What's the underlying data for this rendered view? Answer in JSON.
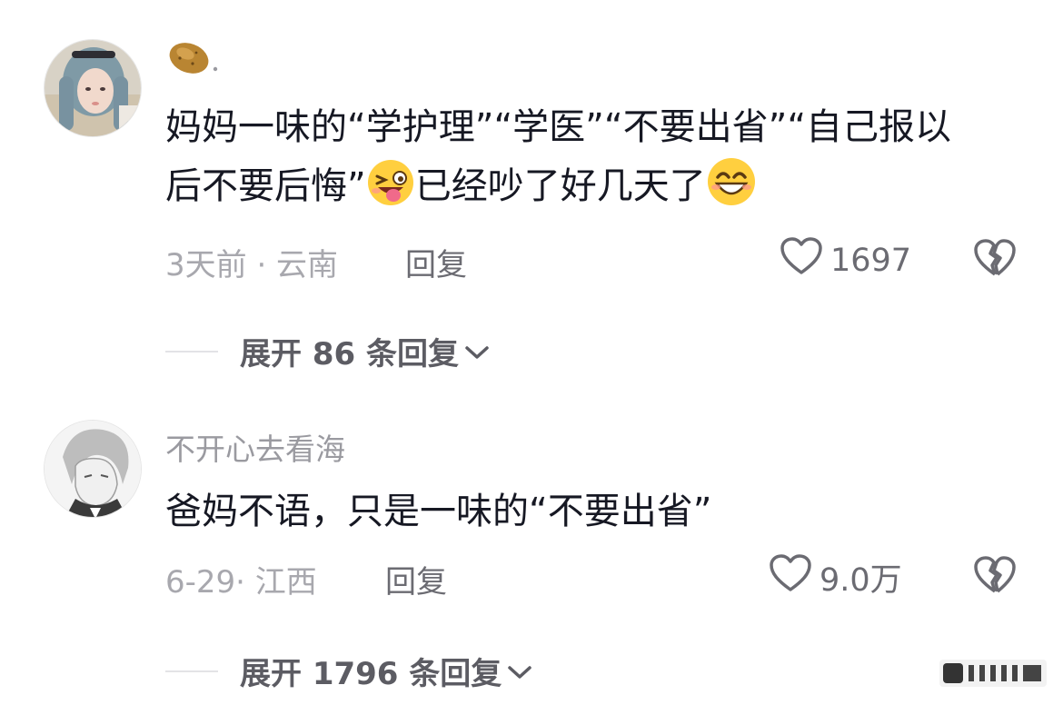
{
  "comments": [
    {
      "username": "",
      "text_part1": "妈妈一味的“学护理”“学医”“不要出省”“自己报以后不要后悔”",
      "emoji1": "grinning-squinting-tongue-emoji",
      "text_part2": "已经吵了好几天了",
      "emoji2": "grinning-smile-emoji",
      "time_location": "3天前 · 云南",
      "reply_label": "回复",
      "like_count": "1697",
      "expand_label": "展开 86 条回复"
    },
    {
      "username": "不开心去看海",
      "text": "爸妈不语，只是一味的“不要出省”",
      "time_location": "6-29· 江西",
      "reply_label": "回复",
      "like_count": "9.0万",
      "expand_label": "展开 1796 条回复"
    }
  ],
  "icons": {
    "like": "heart-outline-icon",
    "dislike": "broken-heart-icon",
    "expand": "chevron-down-icon",
    "username_badge": "potato-emoji"
  },
  "colors": {
    "text": "#161823",
    "meta": "#a8a8ae",
    "secondary": "#6b6b72"
  }
}
